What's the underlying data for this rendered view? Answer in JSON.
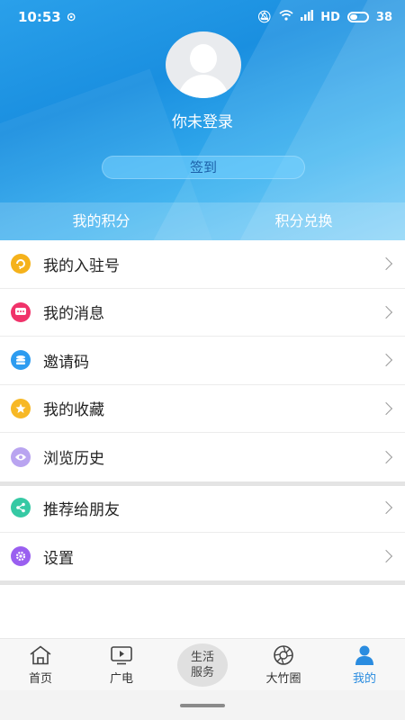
{
  "status_bar": {
    "time": "10:53",
    "battery": "38"
  },
  "profile": {
    "login_prompt": "你未登录",
    "signin_label": "签到"
  },
  "points": {
    "my_points": "我的积分",
    "redeem_points": "积分兑换"
  },
  "menu_group1": [
    {
      "label": "我的入驻号",
      "icon": "settle-account-icon",
      "color": "#f5b21b"
    },
    {
      "label": "我的消息",
      "icon": "message-icon",
      "color": "#f0336a"
    },
    {
      "label": "邀请码",
      "icon": "invite-code-icon",
      "color": "#2d9cf0"
    },
    {
      "label": "我的收藏",
      "icon": "star-icon",
      "color": "#f7b825"
    },
    {
      "label": "浏览历史",
      "icon": "eye-icon",
      "color": "#b9a4f0"
    }
  ],
  "menu_group2": [
    {
      "label": "推荐给朋友",
      "icon": "share-icon",
      "color": "#36c9a4"
    },
    {
      "label": "设置",
      "icon": "gear-icon",
      "color": "#9a5ff0"
    }
  ],
  "tabs": [
    {
      "label": "首页",
      "icon": "home-icon"
    },
    {
      "label": "广电",
      "icon": "tv-icon"
    },
    {
      "label_line1": "生活",
      "label_line2": "服务"
    },
    {
      "label": "大竹圈",
      "icon": "aperture-icon"
    },
    {
      "label": "我的",
      "icon": "user-icon",
      "active_color": "#2a8ce0"
    }
  ]
}
